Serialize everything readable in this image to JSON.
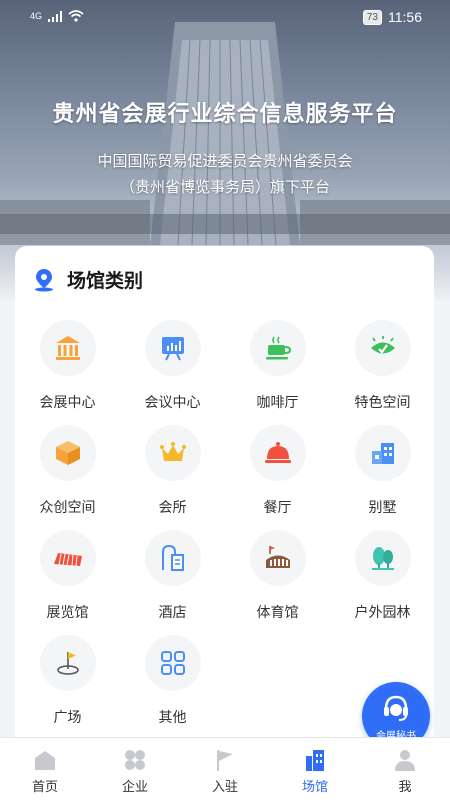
{
  "status_bar": {
    "signal": "4G",
    "battery": "73",
    "time": "11:56"
  },
  "hero": {
    "title": "贵州省会展行业综合信息服务平台",
    "subtitle_line1": "中国国际贸易促进委员会贵州省委员会",
    "subtitle_line2": "（贵州省博览事务局）旗下平台"
  },
  "venue_section": {
    "title": "场馆类别",
    "categories": [
      {
        "label": "会展中心",
        "icon": "exhibition-center-icon",
        "color": "#f5a33a"
      },
      {
        "label": "会议中心",
        "icon": "meeting-board-icon",
        "color": "#4a8ff5"
      },
      {
        "label": "咖啡厅",
        "icon": "coffee-cup-icon",
        "color": "#3fbf5a"
      },
      {
        "label": "特色空间",
        "icon": "eye-icon",
        "color": "#3fbf5a"
      },
      {
        "label": "众创空间",
        "icon": "cube-icon",
        "color": "#f5a33a"
      },
      {
        "label": "会所",
        "icon": "crown-icon",
        "color": "#f5b82a"
      },
      {
        "label": "餐厅",
        "icon": "food-cloche-icon",
        "color": "#f0503c"
      },
      {
        "label": "别墅",
        "icon": "villa-icon",
        "color": "#4a8ff5"
      },
      {
        "label": "展览馆",
        "icon": "exhibition-hall-icon",
        "color": "#f0503c"
      },
      {
        "label": "酒店",
        "icon": "hotel-icon",
        "color": "#4a8ff5"
      },
      {
        "label": "体育馆",
        "icon": "stadium-icon",
        "color": "#8a5a3a"
      },
      {
        "label": "户外园林",
        "icon": "tree-icon",
        "color": "#3fc4b0"
      },
      {
        "label": "广场",
        "icon": "flag-icon",
        "color": "#f5b82a"
      },
      {
        "label": "其他",
        "icon": "grid-icon",
        "color": "#4a8ff5"
      }
    ]
  },
  "fab": {
    "label": "会展秘书"
  },
  "bottom_nav": [
    {
      "label": "首页",
      "icon": "home-icon",
      "active": false
    },
    {
      "label": "企业",
      "icon": "enterprise-icon",
      "active": false
    },
    {
      "label": "入驻",
      "icon": "flag-entry-icon",
      "active": false
    },
    {
      "label": "场馆",
      "icon": "venue-building-icon",
      "active": true
    },
    {
      "label": "我",
      "icon": "user-icon",
      "active": false
    }
  ],
  "colors": {
    "primary": "#2f6df6",
    "icon_gray": "#c7c9cf"
  }
}
